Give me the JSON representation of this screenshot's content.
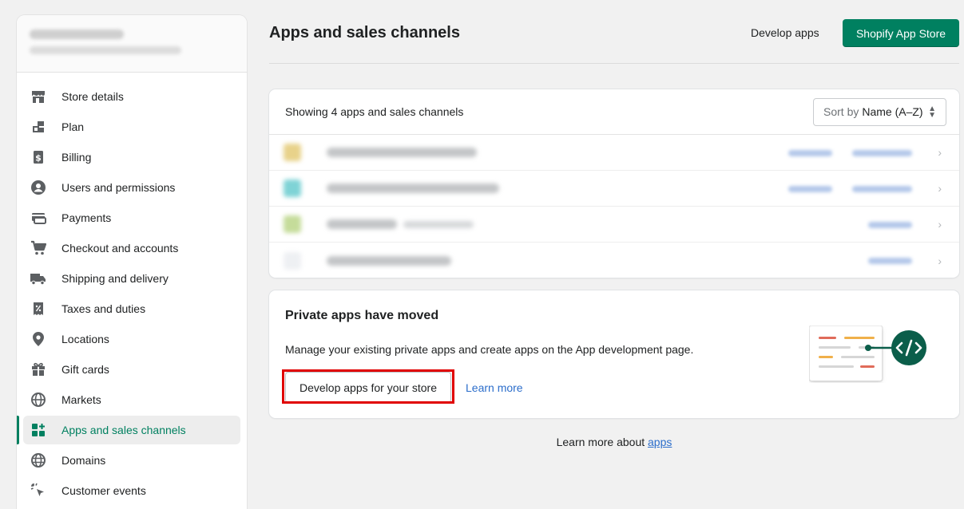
{
  "sidebar": {
    "items": [
      {
        "label": "Store details",
        "icon": "store-icon"
      },
      {
        "label": "Plan",
        "icon": "plan-icon"
      },
      {
        "label": "Billing",
        "icon": "billing-icon"
      },
      {
        "label": "Users and permissions",
        "icon": "user-icon"
      },
      {
        "label": "Payments",
        "icon": "payments-icon"
      },
      {
        "label": "Checkout and accounts",
        "icon": "cart-icon"
      },
      {
        "label": "Shipping and delivery",
        "icon": "truck-icon"
      },
      {
        "label": "Taxes and duties",
        "icon": "receipt-icon"
      },
      {
        "label": "Locations",
        "icon": "location-pin-icon"
      },
      {
        "label": "Gift cards",
        "icon": "gift-icon"
      },
      {
        "label": "Markets",
        "icon": "globe-grid-icon"
      },
      {
        "label": "Apps and sales channels",
        "icon": "apps-icon",
        "active": true
      },
      {
        "label": "Domains",
        "icon": "globe-icon"
      },
      {
        "label": "Customer events",
        "icon": "cursor-click-icon"
      }
    ]
  },
  "header": {
    "title": "Apps and sales channels",
    "develop_apps_label": "Develop apps",
    "app_store_label": "Shopify App Store"
  },
  "apps": {
    "count_label": "Showing 4 apps and sales channels",
    "sort_prefix": "Sort by",
    "sort_value": "Name (A–Z)"
  },
  "private_apps": {
    "title": "Private apps have moved",
    "description": "Manage your existing private apps and create apps on the App development page.",
    "develop_button": "Develop apps for your store",
    "learn_more": "Learn more"
  },
  "footer": {
    "prefix": "Learn more about ",
    "link": "apps"
  },
  "colors": {
    "accent": "#008060",
    "link": "#2c6ecb",
    "highlight": "#e00000"
  }
}
